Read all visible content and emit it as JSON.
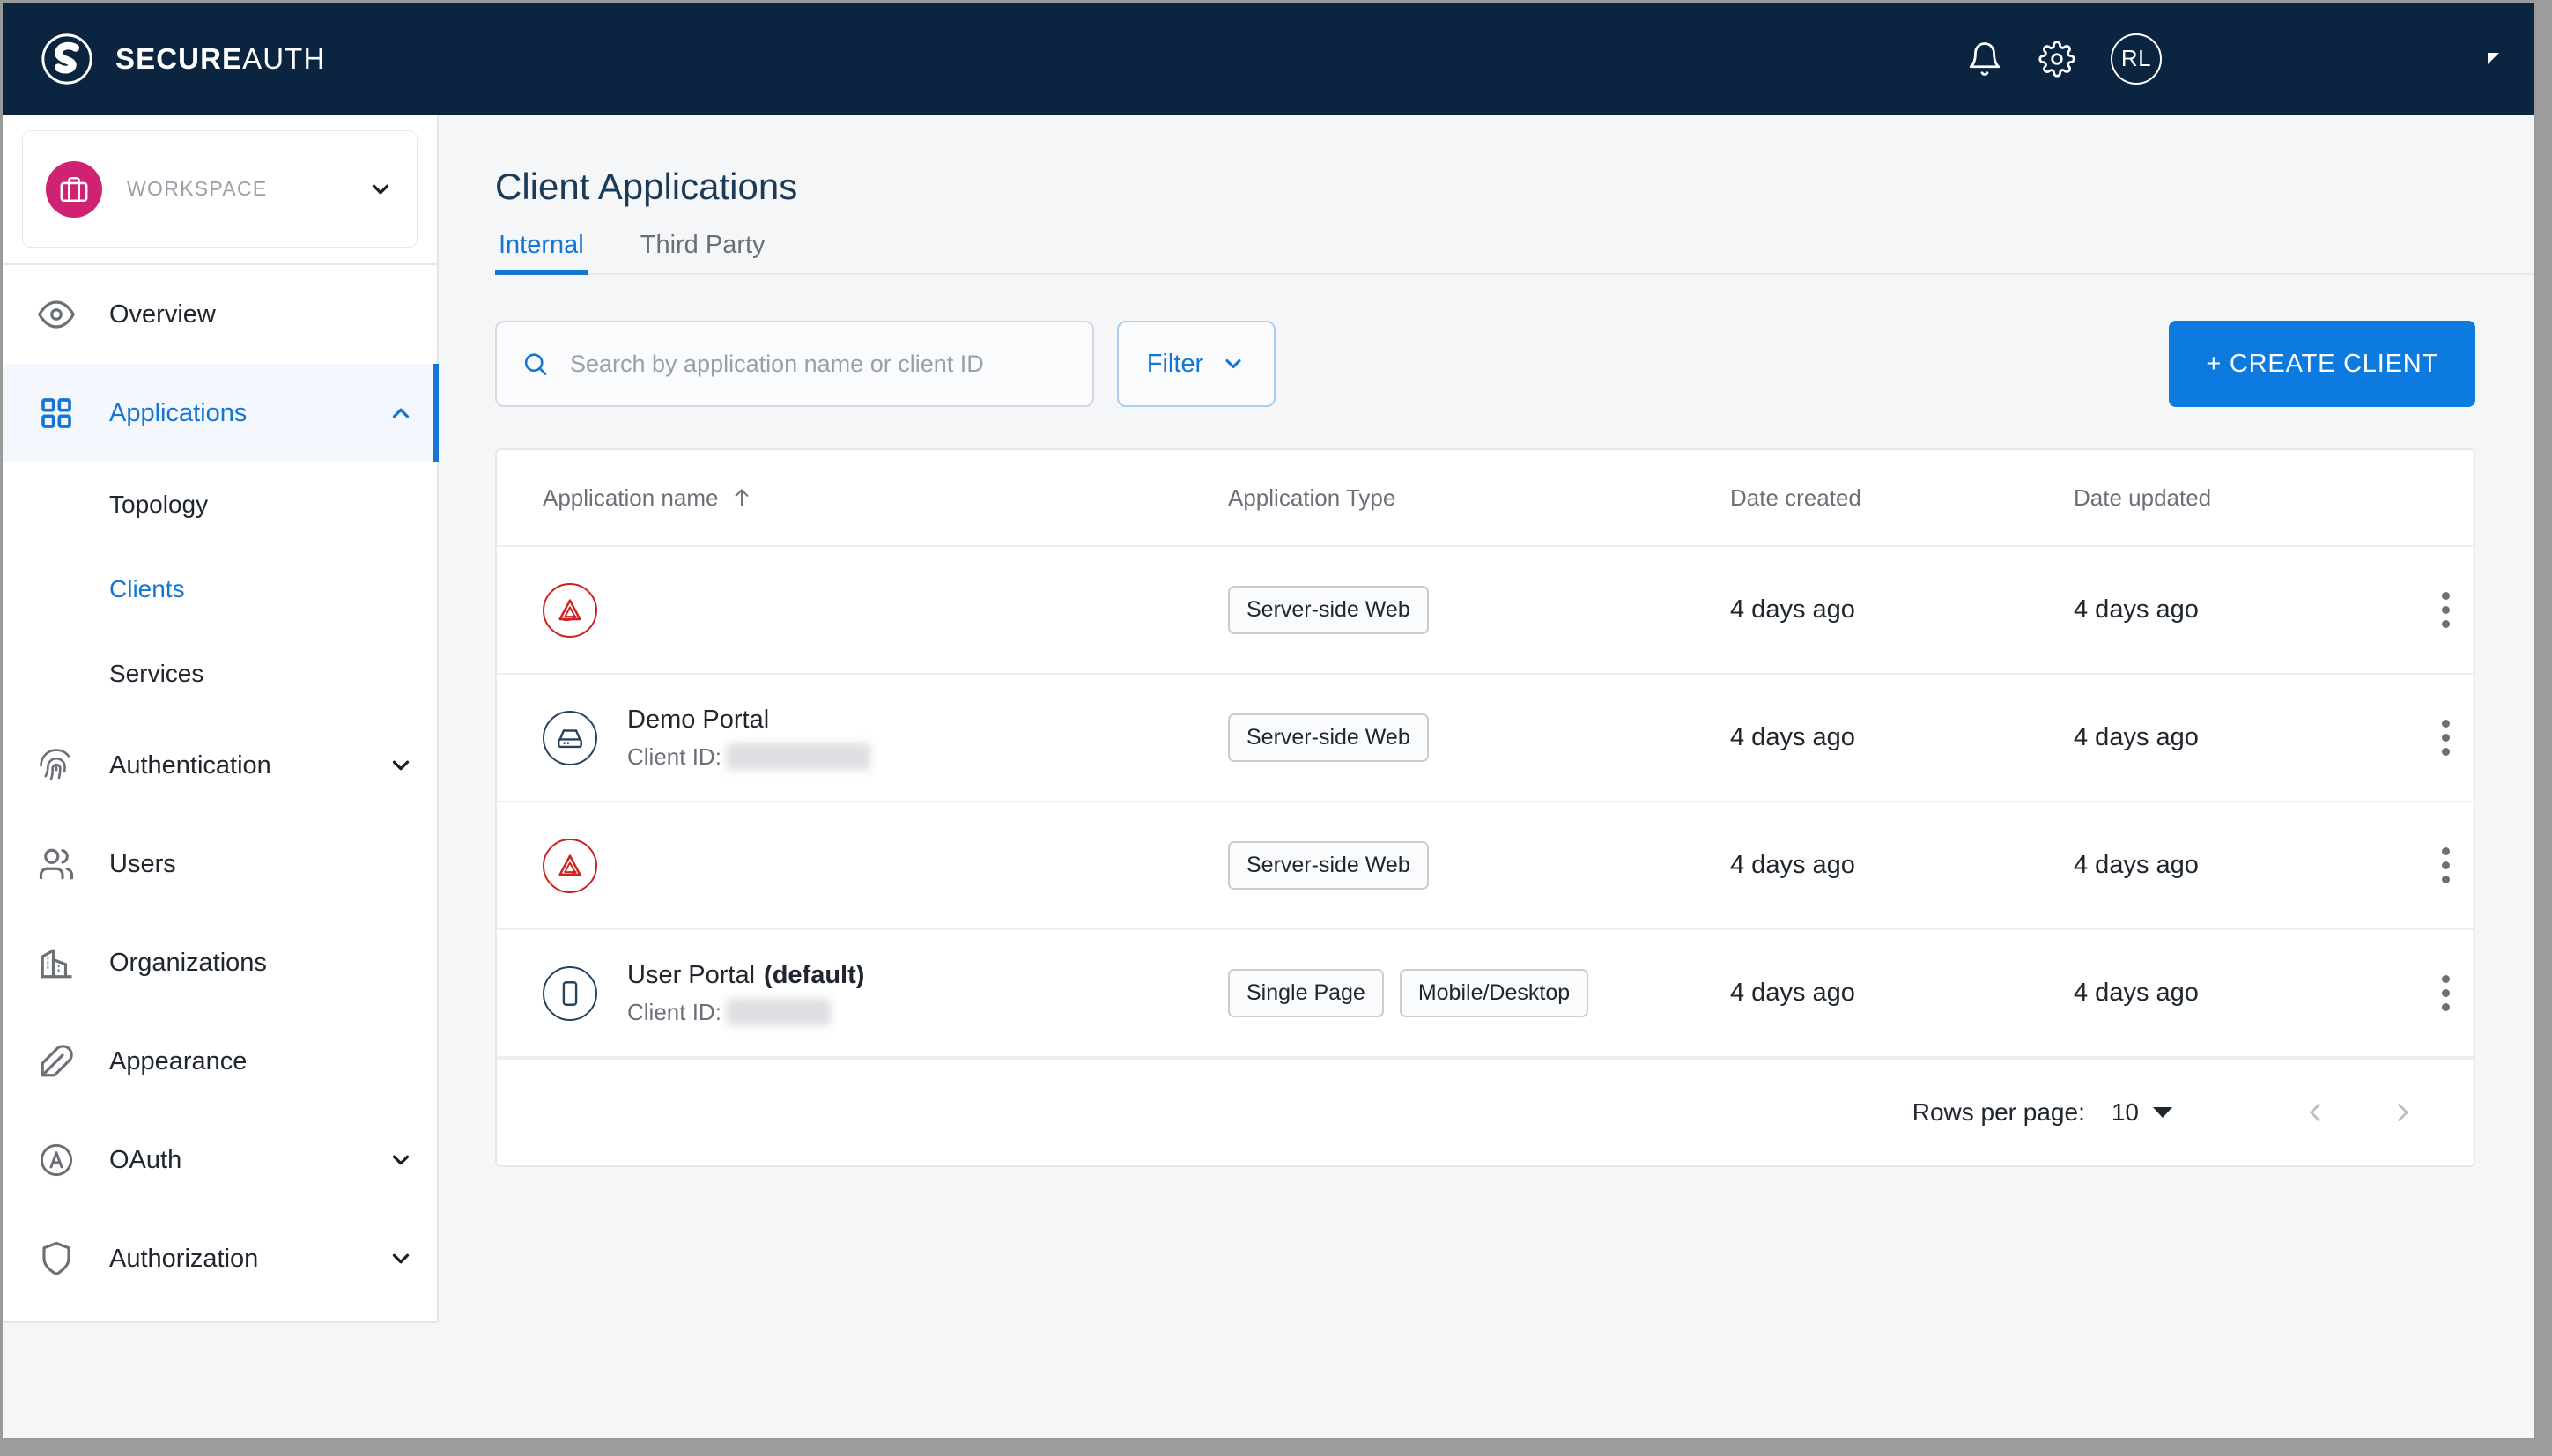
{
  "topbar": {
    "brand_bold": "SECURE",
    "brand_light": "AUTH",
    "notifications_icon": "bell-icon",
    "settings_icon": "gear-icon",
    "avatar_initials": "RL"
  },
  "sidebar": {
    "workspace": {
      "label": "WORKSPACE",
      "icon": "briefcase-icon",
      "chevron": "chevron-down-icon",
      "accent_color": "#cf2372"
    },
    "items": [
      {
        "label": "Overview",
        "icon": "eye-icon",
        "active": false,
        "expandable": false
      },
      {
        "label": "Applications",
        "icon": "grid-icon",
        "active": true,
        "expandable": true,
        "chevron": "chevron-up-icon"
      },
      {
        "label": "Authentication",
        "icon": "fingerprint-icon",
        "active": false,
        "expandable": true,
        "chevron": "chevron-down-icon"
      },
      {
        "label": "Users",
        "icon": "users-icon",
        "active": false,
        "expandable": false
      },
      {
        "label": "Organizations",
        "icon": "building-icon",
        "active": false,
        "expandable": false
      },
      {
        "label": "Appearance",
        "icon": "feather-pen-icon",
        "active": false,
        "expandable": false
      },
      {
        "label": "OAuth",
        "icon": "circled-a-icon",
        "active": false,
        "expandable": true,
        "chevron": "chevron-down-icon"
      },
      {
        "label": "Authorization",
        "icon": "shield-icon",
        "active": false,
        "expandable": true,
        "chevron": "chevron-down-icon"
      }
    ],
    "sub_items": [
      {
        "label": "Topology",
        "active": false
      },
      {
        "label": "Clients",
        "active": true
      },
      {
        "label": "Services",
        "active": false
      }
    ]
  },
  "main": {
    "title": "Client Applications",
    "tabs": [
      {
        "label": "Internal",
        "active": true
      },
      {
        "label": "Third Party",
        "active": false
      }
    ],
    "search": {
      "placeholder": "Search by application name or client ID",
      "value": "",
      "icon": "search-icon"
    },
    "filter_label": "Filter",
    "create_label": "+ CREATE CLIENT",
    "accent_color": "#0d7ae0"
  },
  "table": {
    "columns": [
      {
        "label": "Application name",
        "sort": "ascending"
      },
      {
        "label": "Application Type"
      },
      {
        "label": "Date created"
      },
      {
        "label": "Date updated"
      }
    ],
    "sort_icon": "arrow-up-icon",
    "client_id_label": "Client ID:",
    "rows": [
      {
        "icon": "red-triangle-logo-icon",
        "icon_style": "danger",
        "name": "",
        "default": false,
        "client_id_redacted": false,
        "types": [
          "Server-side Web"
        ],
        "date_created": "4 days ago",
        "date_updated": "4 days ago"
      },
      {
        "icon": "server-icon",
        "icon_style": "normal",
        "name": "Demo Portal",
        "default": false,
        "client_id_redacted": true,
        "client_id_width": 163,
        "types": [
          "Server-side Web"
        ],
        "date_created": "4 days ago",
        "date_updated": "4 days ago"
      },
      {
        "icon": "red-triangle-logo-icon",
        "icon_style": "danger",
        "name": "",
        "default": false,
        "client_id_redacted": false,
        "types": [
          "Server-side Web"
        ],
        "date_created": "4 days ago",
        "date_updated": "4 days ago"
      },
      {
        "icon": "mobile-device-icon",
        "icon_style": "normal",
        "name": "User Portal",
        "default": true,
        "default_label": "(default)",
        "client_id_redacted": true,
        "client_id_width": 118,
        "types": [
          "Single Page",
          "Mobile/Desktop"
        ],
        "date_created": "4 days ago",
        "date_updated": "4 days ago"
      }
    ],
    "row_action_icon": "kebab-menu-icon"
  },
  "pagination": {
    "rows_per_page_label": "Rows per page:",
    "rows_per_page_value": "10",
    "prev_icon": "chevron-left-icon",
    "next_icon": "chevron-right-icon"
  }
}
